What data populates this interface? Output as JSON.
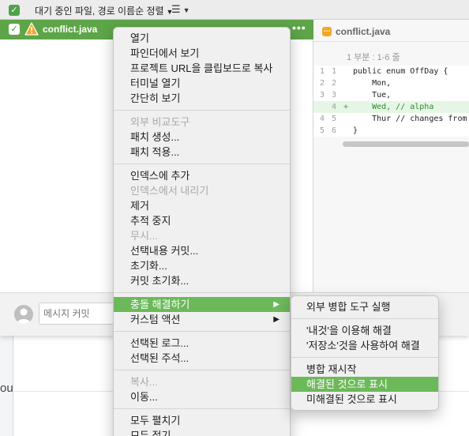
{
  "toolbar": {
    "filter_label": "대기 중인 파일, 경로 이름순 정렬",
    "view_icon": "list-icon"
  },
  "file_list": {
    "selected_file": "conflict.java",
    "status_icon": "warning-triangle-icon",
    "more": "•••"
  },
  "diff": {
    "title": "conflict.java",
    "hunk_label": "1 부분 : 1-6 줄",
    "lines": [
      {
        "old": "1",
        "new": "1",
        "mark": "",
        "text": "public enum OffDay {"
      },
      {
        "old": "2",
        "new": "2",
        "mark": "",
        "text": "    Mon,"
      },
      {
        "old": "3",
        "new": "3",
        "mark": "",
        "text": "    Tue,"
      },
      {
        "old": "",
        "new": "4",
        "mark": "+",
        "text": "    Wed, // alpha"
      },
      {
        "old": "4",
        "new": "5",
        "mark": "",
        "text": "    Thur // changes from"
      },
      {
        "old": "5",
        "new": "6",
        "mark": "",
        "text": "}"
      }
    ]
  },
  "commit": {
    "placeholder": "메시지 커밋"
  },
  "context_menu": {
    "groups": [
      [
        {
          "label": "열기",
          "enabled": true
        },
        {
          "label": "파인더에서 보기",
          "enabled": true
        },
        {
          "label": "프로젝트 URL을 클립보드로 복사",
          "enabled": true
        },
        {
          "label": "터미널 열기",
          "enabled": true
        },
        {
          "label": "간단히 보기",
          "enabled": true
        }
      ],
      [
        {
          "label": "외부 비교도구",
          "enabled": false
        },
        {
          "label": "패치 생성...",
          "enabled": true
        },
        {
          "label": "패치 적용...",
          "enabled": true
        }
      ],
      [
        {
          "label": "인덱스에 추가",
          "enabled": true
        },
        {
          "label": "인덱스에서 내리기",
          "enabled": false
        },
        {
          "label": "제거",
          "enabled": true
        },
        {
          "label": "추적 중지",
          "enabled": true
        },
        {
          "label": "무시...",
          "enabled": false
        },
        {
          "label": "선택내용 커밋...",
          "enabled": true
        },
        {
          "label": "초기화...",
          "enabled": true
        },
        {
          "label": "커밋 초기화...",
          "enabled": true
        }
      ],
      [
        {
          "label": "충돌 해결하기",
          "enabled": true,
          "submenu": true,
          "highlight": true
        },
        {
          "label": "커스텀 액션",
          "enabled": true,
          "submenu": true
        }
      ],
      [
        {
          "label": "선택된 로그...",
          "enabled": true
        },
        {
          "label": "선택된 주석...",
          "enabled": true
        }
      ],
      [
        {
          "label": "복사...",
          "enabled": false
        },
        {
          "label": "이동...",
          "enabled": true
        }
      ],
      [
        {
          "label": "모두 펼치기",
          "enabled": true
        },
        {
          "label": "모두 접기",
          "enabled": true
        }
      ]
    ]
  },
  "submenu": {
    "groups": [
      [
        {
          "label": "외부 병합 도구 실행",
          "enabled": true
        }
      ],
      [
        {
          "label": "'내것'을 이용해 해결",
          "enabled": true
        },
        {
          "label": "'저장소'것을 사용하여 해결",
          "enabled": true
        }
      ],
      [
        {
          "label": "병합 재시작",
          "enabled": true
        },
        {
          "label": "해결된 것으로 표시",
          "enabled": true,
          "highlight": true
        },
        {
          "label": "미해결된 것으로 표시",
          "enabled": true
        }
      ]
    ]
  },
  "background": {
    "fragment": "ou"
  },
  "colors": {
    "accent_green": "#5da548",
    "menu_highlight": "#6cb95a",
    "warning_orange": "#f5a623"
  }
}
